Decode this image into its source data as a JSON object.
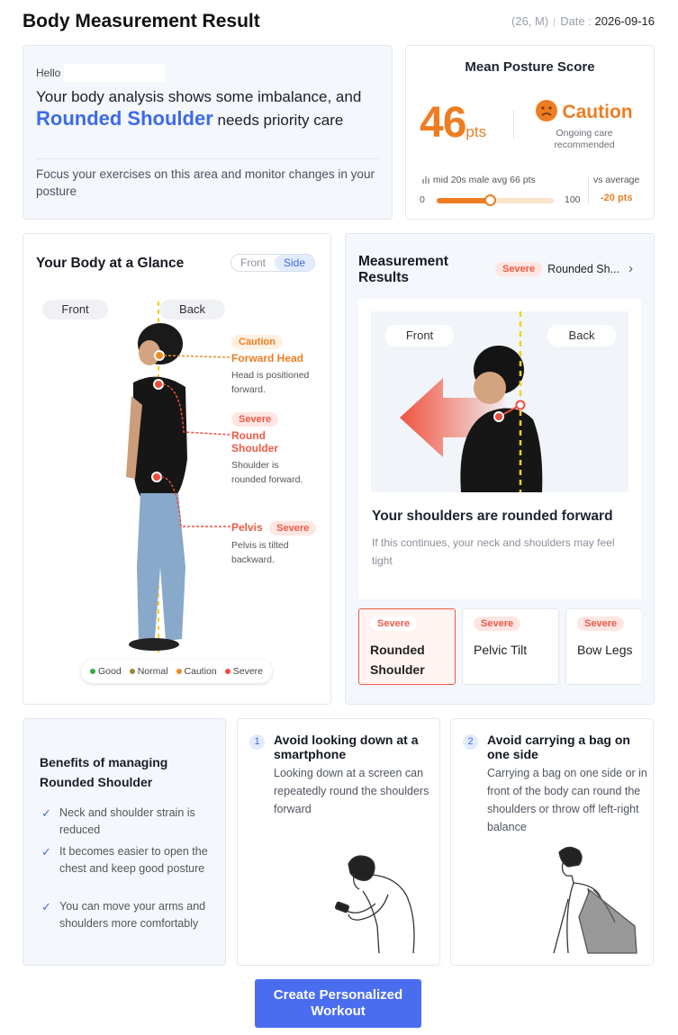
{
  "header": {
    "title": "Body Measurement Result",
    "user_info": "(26, M)",
    "date_label": "Date :",
    "date_value": "2026-09-16"
  },
  "summary": {
    "hello": "Hello",
    "headline_pre": "Your body analysis shows some imbalance, and",
    "headline_accent": "Rounded Shoulder",
    "headline_post": "needs priority care",
    "focus_text": "Focus your exercises on this area and monitor changes in your posture"
  },
  "score": {
    "title": "Mean Posture Score",
    "value": "46",
    "unit": "pts",
    "status": "Caution",
    "status_sub": "Ongoing care recommended",
    "avg_label": "mid 20s male avg 66 pts",
    "scale_min": "0",
    "scale_max": "100",
    "slider_fraction": 0.46,
    "vs_label": "vs average",
    "vs_value": "-20 pts",
    "accent_color": "#ee7d22"
  },
  "glance": {
    "title": "Your Body at a Glance",
    "toggle_front": "Front",
    "toggle_side": "Side",
    "front_label": "Front",
    "back_label": "Back",
    "findings": [
      {
        "badge": "Caution",
        "name": "Forward Head",
        "desc": "Head is positioned forward."
      },
      {
        "badge": "Severe",
        "name": "Round Shoulder",
        "desc": "Shoulder is rounded forward."
      },
      {
        "badge": "Severe",
        "name": "Pelvis",
        "desc": "Pelvis is tilted backward."
      }
    ],
    "legend": [
      {
        "label": "Good",
        "color": "#2fae3b"
      },
      {
        "label": "Normal",
        "color": "#a0842e"
      },
      {
        "label": "Caution",
        "color": "#ee8c22"
      },
      {
        "label": "Severe",
        "color": "#ef4c3a"
      }
    ]
  },
  "results": {
    "title": "Measurement Results",
    "badge": "Severe",
    "selected": "Rounded Sh...",
    "front_label": "Front",
    "back_label": "Back",
    "heading": "Your shoulders are rounded forward",
    "sub": "If this continues, your neck and shoulders may feel tight",
    "tabs": [
      {
        "badge": "Severe",
        "name": "Rounded Shoulder"
      },
      {
        "badge": "Severe",
        "name": "Pelvic Tilt"
      },
      {
        "badge": "Severe",
        "name": "Bow Legs"
      }
    ]
  },
  "benefits": {
    "title": "Benefits of managing Rounded Shoulder",
    "items": [
      "Neck and shoulder strain is reduced",
      "It becomes easier to open the chest and keep good posture",
      "You can move your arms and shoulders more comfortably"
    ]
  },
  "tips": [
    {
      "num": "1",
      "title": "Avoid looking down at a smartphone",
      "desc": "Looking down at a screen can repeatedly round the shoulders forward"
    },
    {
      "num": "2",
      "title": "Avoid carrying a bag on one side",
      "desc": "Carrying a bag on one side or in front of the body can round the shoulders or throw off left-right balance"
    }
  ],
  "cta": {
    "label": "Create Personalized Workout"
  }
}
